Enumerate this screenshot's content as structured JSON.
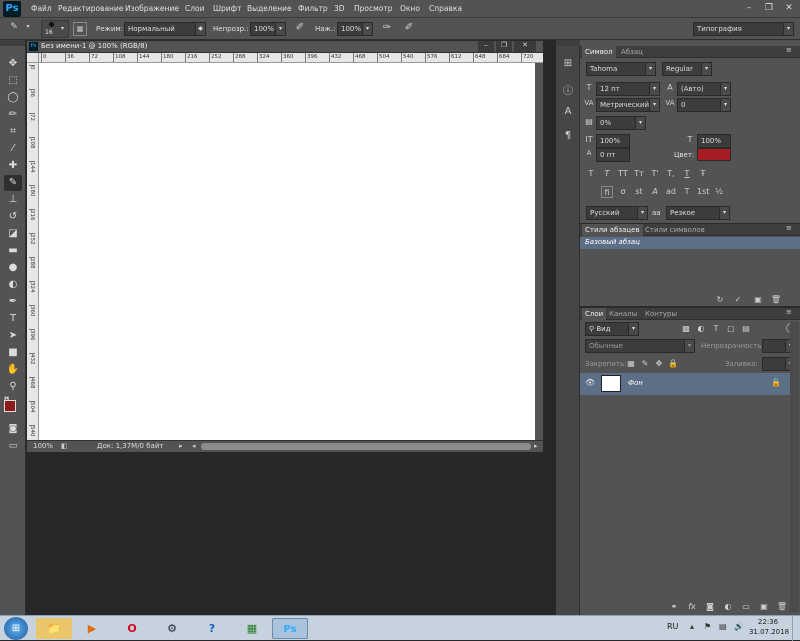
{
  "app": {
    "logo": "Ps"
  },
  "menu": [
    "Файл",
    "Редактирование",
    "Изображение",
    "Слои",
    "Шрифт",
    "Выделение",
    "Фильтр",
    "3D",
    "Просмотр",
    "Окно",
    "Справка"
  ],
  "window_controls": {
    "minimize": "–",
    "restore": "❐",
    "close": "✕"
  },
  "options": {
    "brush_size": "16",
    "mode_label": "Режим:",
    "mode_value": "Нормальный",
    "opacity_label": "Непрозр.:",
    "opacity_value": "100%",
    "pressure_label": "Наж.:",
    "pressure_value": "100%",
    "workspace": "Типография"
  },
  "document": {
    "tab_title": "Без имени-1 @ 100% (RGB/8)",
    "ruler_ticks": [
      "0",
      "36",
      "72",
      "108",
      "144",
      "180",
      "216",
      "252",
      "288",
      "324",
      "360",
      "396",
      "432",
      "468",
      "504",
      "540",
      "576",
      "612",
      "648",
      "684",
      "720"
    ],
    "zoom": "100%",
    "doc_info": "Док: 1,37М/0 байт"
  },
  "character_panel": {
    "tabs": [
      "Символ",
      "Абзац"
    ],
    "font_family": "Tahoma",
    "font_style": "Regular",
    "font_size": "12 пт",
    "leading": "(Авто)",
    "kerning": "Метрический",
    "tracking": "0",
    "tsume": "0%",
    "vscale": "100%",
    "hscale": "100%",
    "baseline": "0 пт",
    "color_label": "Цвет:",
    "color": "#a81d24",
    "language": "Русский",
    "antialias_label": "aa",
    "antialias": "Резкое",
    "type_buttons": [
      "T",
      "T",
      "TT",
      "Tт",
      "T'",
      "T,",
      "T",
      "Ŧ"
    ],
    "ot_buttons": [
      "fi",
      "σ",
      "st",
      "A",
      "ad",
      "T",
      "1st",
      "½"
    ]
  },
  "styles_panel": {
    "tabs": [
      "Стили абзацев",
      "Стили символов"
    ],
    "selected": "Базовый абзац"
  },
  "layers_panel": {
    "tabs": [
      "Слои",
      "Каналы",
      "Контуры"
    ],
    "filter": "Вид",
    "blend_mode": "Обычные",
    "opacity_label": "Непрозрачность:",
    "lock_label": "Закрепить:",
    "fill_label": "Заливка:",
    "layers": [
      {
        "name": "Фон"
      }
    ]
  },
  "taskbar": {
    "language": "RU",
    "time": "22:36",
    "date": "31.07.2018"
  }
}
